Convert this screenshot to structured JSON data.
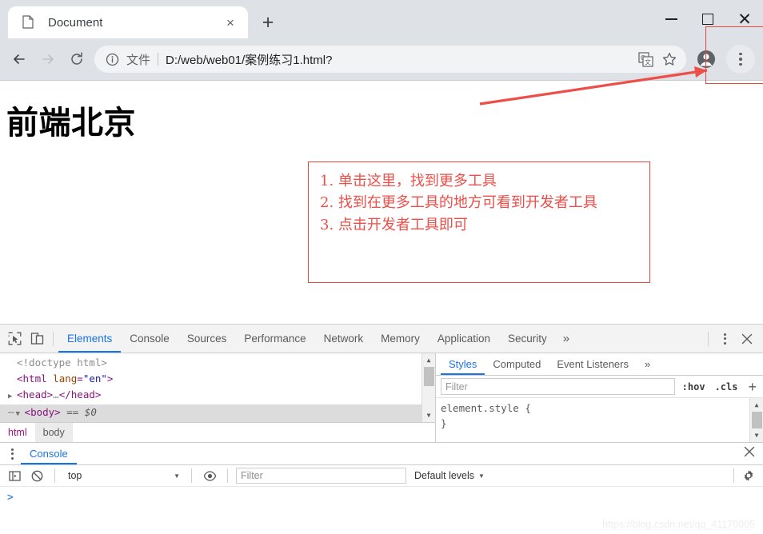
{
  "browser": {
    "tab": {
      "title": "Document",
      "favicon": "document-icon",
      "close_label": "×"
    },
    "new_tab_label": "+",
    "window_controls": {
      "minimize": "—",
      "maximize": "□",
      "close": "✕"
    },
    "toolbar": {
      "back": "←",
      "forward": "→",
      "reload": "↻",
      "omnibox": {
        "info_icon": "info-circle-icon",
        "scheme_label": "文件",
        "separator": "|",
        "url": "D:/web/web01/案例练习1.html?",
        "translate_icon": "translate-icon",
        "bookmark_icon": "star-icon"
      },
      "profile_icon": "account-avatar-icon",
      "menu_icon": "three-dot-menu-icon"
    }
  },
  "page": {
    "heading": "前端北京"
  },
  "annotation": {
    "color": "#ee4e48",
    "lines": [
      "1. 单击这里，找到更多工具",
      "2. 找到在更多工具的地方可看到开发者工具",
      "3. 点击开发者工具即可"
    ]
  },
  "devtools": {
    "inspect_icon": "inspect-element-icon",
    "device_icon": "device-toolbar-icon",
    "tabs": [
      {
        "label": "Elements",
        "active": true
      },
      {
        "label": "Console",
        "active": false
      },
      {
        "label": "Sources",
        "active": false
      },
      {
        "label": "Performance",
        "active": false
      },
      {
        "label": "Network",
        "active": false
      },
      {
        "label": "Memory",
        "active": false
      },
      {
        "label": "Application",
        "active": false
      },
      {
        "label": "Security",
        "active": false
      }
    ],
    "more_tabs": "»",
    "menu_icon": "three-dot-menu-icon",
    "close_label": "✕",
    "dom": {
      "lines": [
        {
          "text": "<!doctype html>",
          "kind": "doctype"
        },
        {
          "text": "<html lang=\"en\">",
          "kind": "open-tag"
        },
        {
          "text": "<head>…</head>",
          "kind": "collapsed"
        },
        {
          "text": "<body> == $0",
          "kind": "selected"
        }
      ],
      "doctype": "<!doctype html>",
      "html_tag": "html",
      "html_attr_name": "lang",
      "html_attr_value": "\"en\"",
      "head_tag": "head",
      "body_tag": "body",
      "body_marker": "== $0",
      "ellipsis": "…"
    },
    "breadcrumb": [
      {
        "label": "html",
        "active": false
      },
      {
        "label": "body",
        "active": true
      }
    ],
    "styles": {
      "tabs": [
        {
          "label": "Styles",
          "active": true
        },
        {
          "label": "Computed",
          "active": false
        },
        {
          "label": "Event Listeners",
          "active": false
        }
      ],
      "more_tabs": "»",
      "filter_placeholder": "Filter",
      "filter_value": "",
      "hov_label": ":hov",
      "cls_label": ".cls",
      "add_label": "+",
      "rule_selector": "element.style {",
      "rule_close": "}"
    }
  },
  "drawer": {
    "menu_icon": "three-dot-menu-icon",
    "tab_label": "Console",
    "close_label": "✕",
    "toolbar": {
      "sidebar_icon": "console-sidebar-icon",
      "clear_icon": "clear-console-icon",
      "context_value": "top",
      "eye_icon": "live-expression-icon",
      "filter_placeholder": "Filter",
      "filter_value": "",
      "levels_label": "Default levels",
      "settings_icon": "gear-icon"
    },
    "prompt": ">"
  },
  "watermark": "https://blog.csdn.net/qq_41170005"
}
